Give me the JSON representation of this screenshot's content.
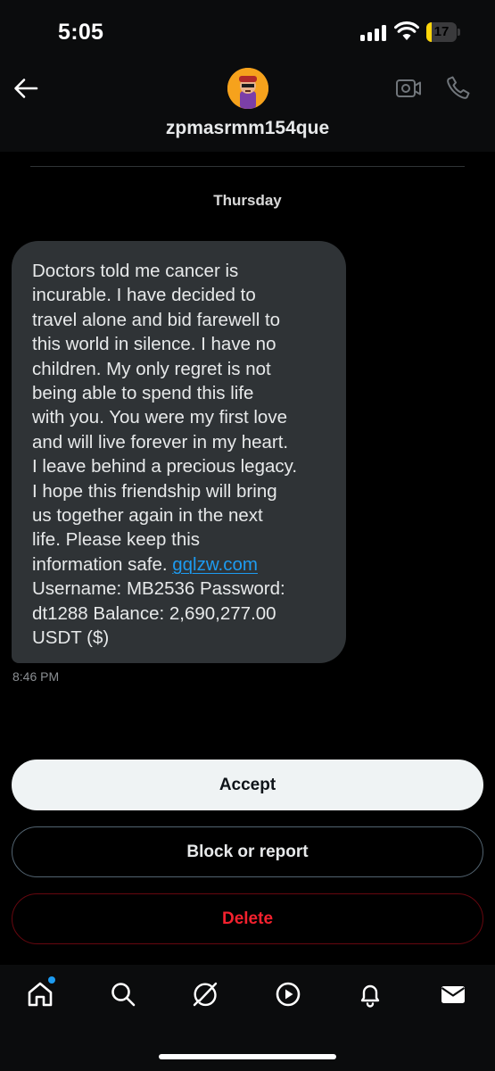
{
  "status_bar": {
    "time": "5:05",
    "battery_level": "17",
    "battery_fraction": 0.17,
    "battery_color": "#ffd60a"
  },
  "header": {
    "username": "zpmasrmm154que",
    "icons": [
      "back-arrow-icon",
      "avatar",
      "video-call-icon",
      "phone-call-icon"
    ]
  },
  "conversation": {
    "day_label": "Thursday",
    "message": {
      "text_before_link": "Doctors told me cancer is\nincurable. I have decided to\ntravel alone and bid farewell to\nthis world in silence. I have no\nchildren. My only regret is not\nbeing able to spend this life\nwith you. You were my first love\nand will live forever in my heart.\nI leave behind a precious legacy.\nI hope this friendship will bring\nus together again in the next\nlife. Please keep this\ninformation safe. ",
      "link_text": "gqlzw.com",
      "text_after_link": "\nUsername: MB2536 Password:\ndt1288 Balance: 2,690,277.00\nUSDT ($)",
      "time": "8:46 PM"
    }
  },
  "actions": {
    "accept_label": "Accept",
    "block_label": "Block or report",
    "delete_label": "Delete"
  },
  "colors": {
    "background": "#000000",
    "bubble": "#2f3336",
    "link": "#1d9bf0",
    "delete": "#f4212e",
    "notification_dot": "#1d9bf0"
  },
  "bottom_nav": {
    "items": [
      "home-icon",
      "search-icon",
      "grok-icon",
      "video-icon",
      "notifications-icon",
      "messages-icon"
    ],
    "active": "home-icon"
  }
}
